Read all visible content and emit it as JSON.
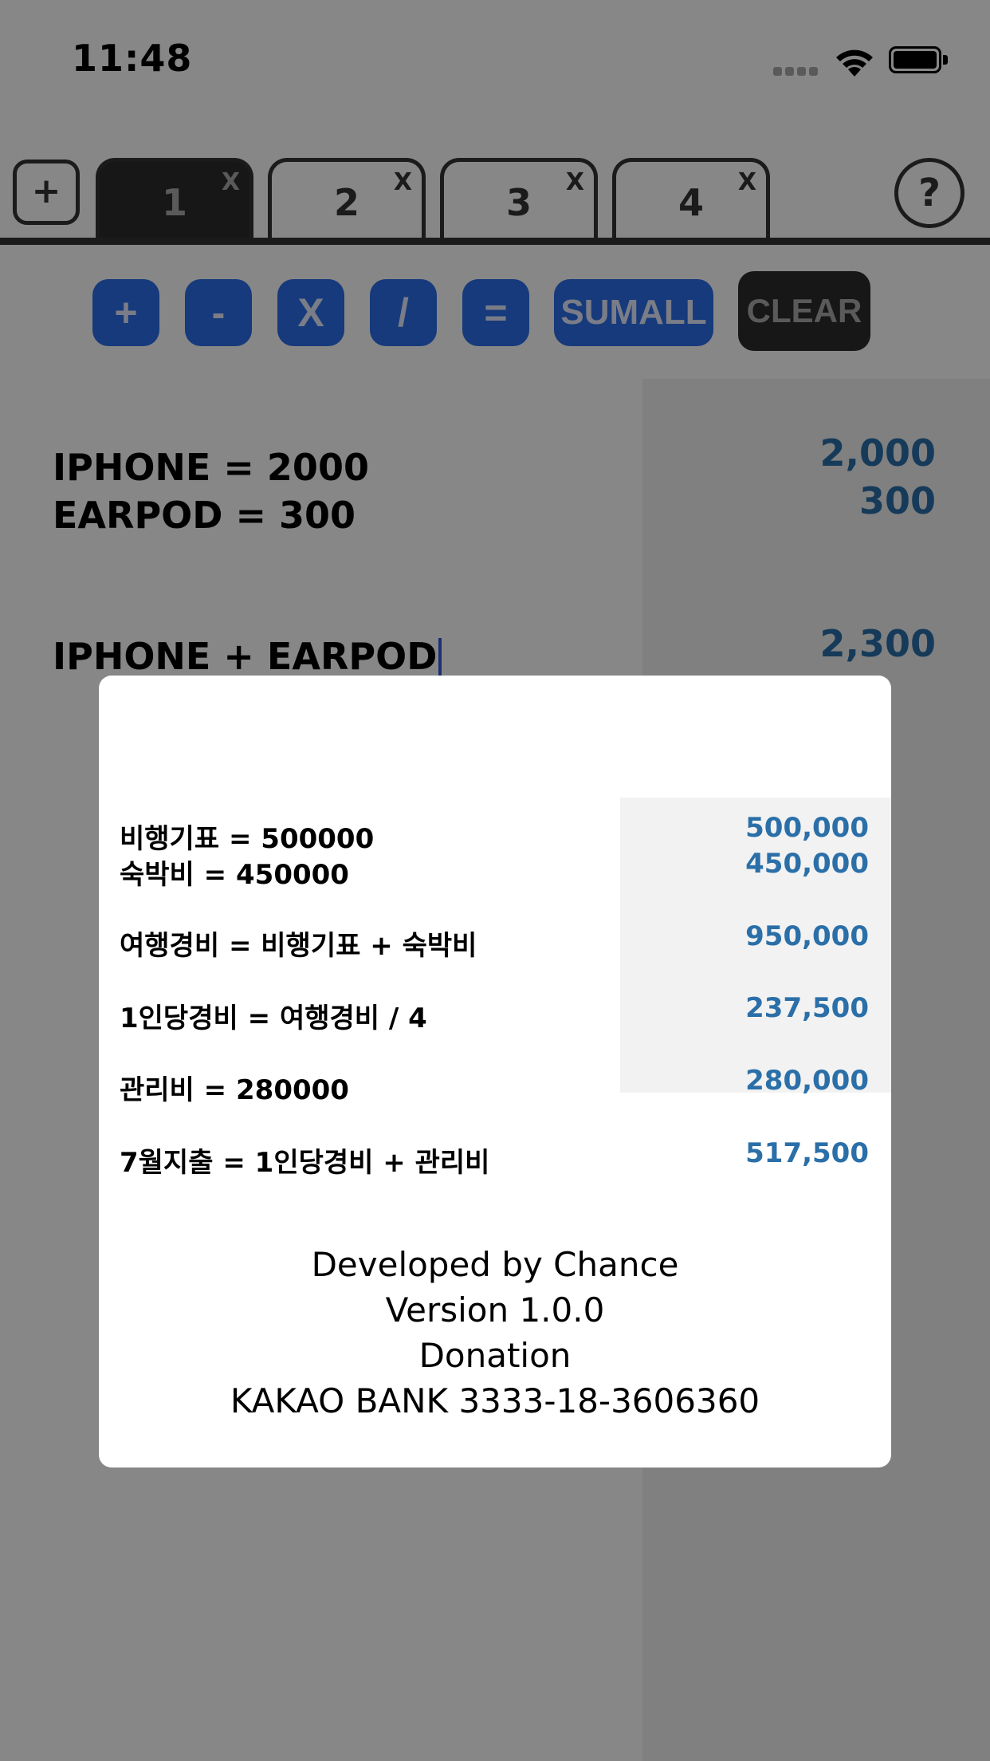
{
  "status_bar": {
    "time": "11:48"
  },
  "tabs": {
    "add_label": "+",
    "items": [
      {
        "label": "1",
        "close": "X",
        "active": true
      },
      {
        "label": "2",
        "close": "X",
        "active": false
      },
      {
        "label": "3",
        "close": "X",
        "active": false
      },
      {
        "label": "4",
        "close": "X",
        "active": false
      }
    ],
    "help_label": "?"
  },
  "operators": {
    "plus": "+",
    "minus": "-",
    "multiply": "X",
    "divide": "/",
    "equals": "=",
    "sumall": "SUMALL",
    "clear": "CLEAR"
  },
  "sheet": {
    "lines": [
      {
        "expr": "IPHONE = 2000",
        "result": "2,000"
      },
      {
        "expr": "EARPOD = 300",
        "result": "300"
      },
      {
        "expr": "IPHONE + EARPOD",
        "result": "2,300"
      }
    ]
  },
  "modal": {
    "example": [
      {
        "expr": "비행기표 = 500000",
        "result": "500,000"
      },
      {
        "expr": "숙박비 = 450000",
        "result": "450,000"
      },
      {
        "expr": "여행경비 = 비행기표 + 숙박비",
        "result": "950,000"
      },
      {
        "expr": "1인당경비 = 여행경비 / 4",
        "result": "237,500"
      },
      {
        "expr": "관리비 = 280000",
        "result": "280,000"
      },
      {
        "expr": "7월지출 = 1인당경비 + 관리비",
        "result": "517,500"
      }
    ],
    "credits": {
      "developer": "Developed by Chance",
      "version": "Version 1.0.0",
      "donation": "Donation",
      "account": "KAKAO BANK 3333-18-3606360"
    }
  },
  "colors": {
    "accent_blue": "#2a6ee8",
    "result_blue": "#2b6fa8",
    "dark": "#2c2c2c"
  }
}
